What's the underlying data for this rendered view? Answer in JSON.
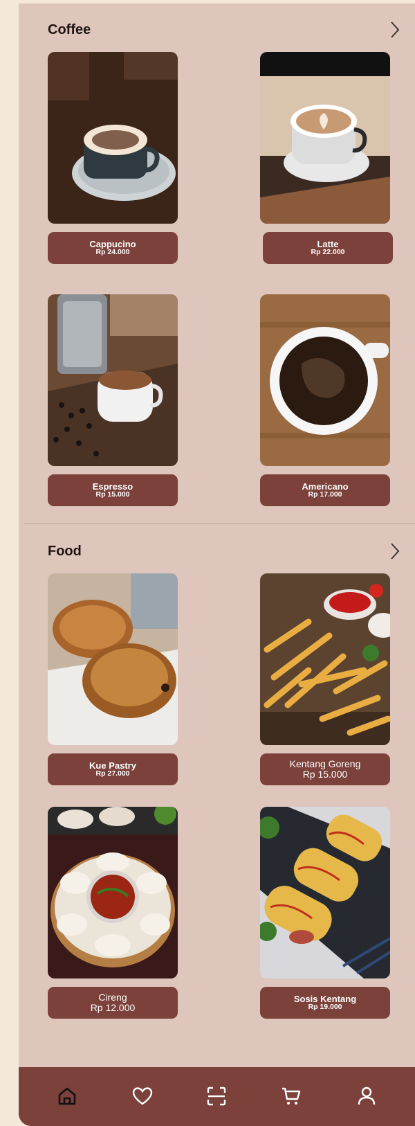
{
  "sections": [
    {
      "title": "Coffee",
      "items": [
        {
          "name": "Cappucino",
          "price": "Rp 24.000"
        },
        {
          "name": "Latte",
          "price": "Rp 22.000"
        },
        {
          "name": "Espresso",
          "price": "Rp 15.000"
        },
        {
          "name": "Americano",
          "price": "Rp 17.000"
        }
      ]
    },
    {
      "title": "Food",
      "items": [
        {
          "name": "Kue Pastry",
          "price": "Rp 27.000"
        },
        {
          "name": "Kentang Goreng",
          "price": "Rp 15.000"
        },
        {
          "name": "Cireng",
          "price": "Rp 12.000"
        },
        {
          "name": "Sosis Kentang",
          "price": "Rp 19.000"
        }
      ]
    }
  ],
  "nav": {
    "items": [
      {
        "icon": "home-icon",
        "active": true
      },
      {
        "icon": "heart-icon"
      },
      {
        "icon": "scan-icon"
      },
      {
        "icon": "cart-icon"
      },
      {
        "icon": "user-icon"
      }
    ]
  },
  "colors": {
    "background": "#dec6bd",
    "accent": "#7b413a",
    "page": "#f3e8da"
  }
}
